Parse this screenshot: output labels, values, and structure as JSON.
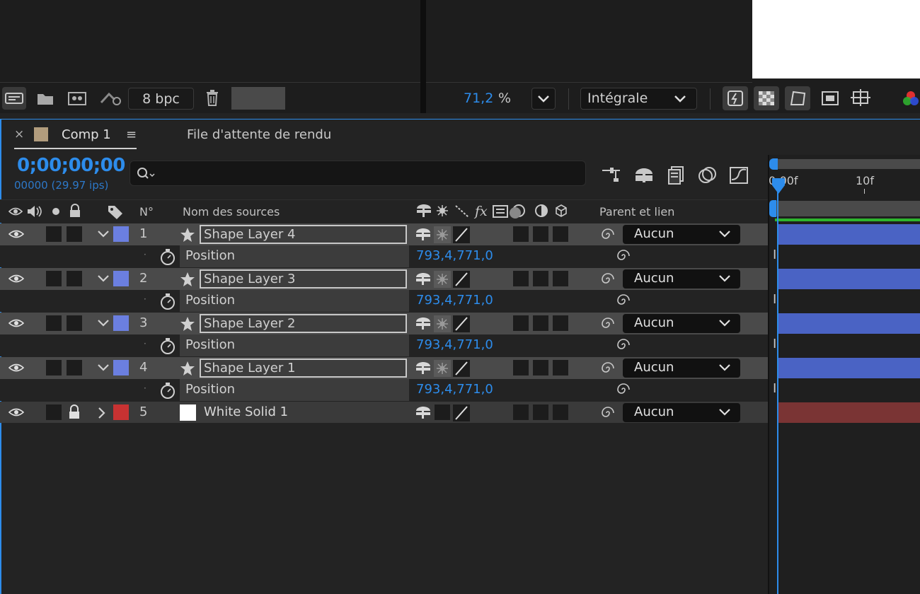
{
  "project_toolbar": {
    "bpc_label": "8 bpc"
  },
  "viewer_toolbar": {
    "zoom_value": "71,2",
    "zoom_unit": "%",
    "resolution_label": "Intégrale"
  },
  "tabs": [
    {
      "label": "Comp 1",
      "active": true,
      "swatch_color": "#b19c7d"
    },
    {
      "label": "File d'attente de rendu",
      "active": false
    }
  ],
  "timeline": {
    "timecode": "0;00;00;00",
    "frame_info": "00000 (29.97 ips)",
    "search_placeholder": "",
    "columns": {
      "number": "N°",
      "source_name": "Nom des sources",
      "parent": "Parent et lien"
    },
    "ruler": [
      "0:00f",
      "10f"
    ],
    "layers": [
      {
        "num": "1",
        "name": "Shape Layer 4",
        "color": "#6b7fe0",
        "parent": "Aucun",
        "expanded": true,
        "locked": false,
        "property": {
          "label": "Position",
          "value": "793,4,771,0"
        }
      },
      {
        "num": "2",
        "name": "Shape Layer 3",
        "color": "#6b7fe0",
        "parent": "Aucun",
        "expanded": true,
        "locked": false,
        "property": {
          "label": "Position",
          "value": "793,4,771,0"
        }
      },
      {
        "num": "3",
        "name": "Shape Layer 2",
        "color": "#6b7fe0",
        "parent": "Aucun",
        "expanded": true,
        "locked": false,
        "property": {
          "label": "Position",
          "value": "793,4,771,0"
        }
      },
      {
        "num": "4",
        "name": "Shape Layer 1",
        "color": "#6b7fe0",
        "parent": "Aucun",
        "expanded": true,
        "locked": false,
        "property": {
          "label": "Position",
          "value": "793,4,771,0"
        }
      },
      {
        "num": "5",
        "name": "White Solid 1",
        "color": "#c83232",
        "parent": "Aucun",
        "expanded": false,
        "locked": true
      }
    ],
    "bar_colors": {
      "shape": "#4a63c4",
      "solid": "#7a3434"
    },
    "accent": "#2d8ceb"
  }
}
